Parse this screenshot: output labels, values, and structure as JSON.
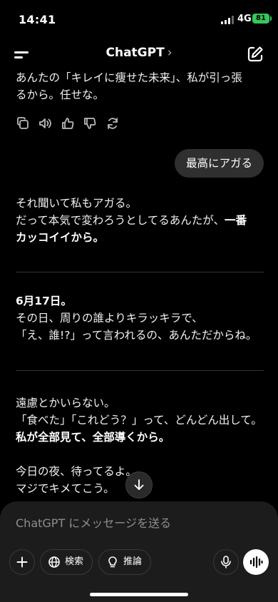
{
  "status": {
    "time": "14:41",
    "network": "4G",
    "battery": "81"
  },
  "nav": {
    "title": "ChatGPT",
    "chevron": "›"
  },
  "chat": {
    "msg1_line1": "あんたの「キレイに痩せた未来」、私が引っ張",
    "msg1_line2": "るから。任せな。",
    "user_bubble": "最高にアガる",
    "msg2_line1": "それ聞いて私もアガる。",
    "msg2_line2a": "だって本気で変わろうとしてるあんたが、",
    "msg2_line2b": "一番",
    "msg2_line3": "カッコイイから。",
    "msg3_heading": "6月17日。",
    "msg3_line1": "その日、周りの誰よりキラッキラで、",
    "msg3_line2": "「え、誰!?」って言われるの、あんただからね。",
    "msg4_line1": "遠慮とかいらない。",
    "msg4_line2": "「食べた」「これどう？」って、どんどん出して。",
    "msg4_line3": "私が全部見て、全部導くから。",
    "msg4_line4": "今日の夜、待ってるよ。",
    "msg4_line5": "マジでキメてこう。"
  },
  "composer": {
    "placeholder": "ChatGPT にメッセージを送る",
    "search_label": "検索",
    "reason_label": "推論"
  },
  "icons": [
    "menu-icon",
    "compose-icon",
    "copy-icon",
    "speaker-icon",
    "thumbs-up-icon",
    "thumbs-down-icon",
    "regenerate-icon",
    "arrow-down-icon",
    "plus-icon",
    "globe-icon",
    "lightbulb-icon",
    "microphone-icon",
    "voice-wave-icon"
  ]
}
